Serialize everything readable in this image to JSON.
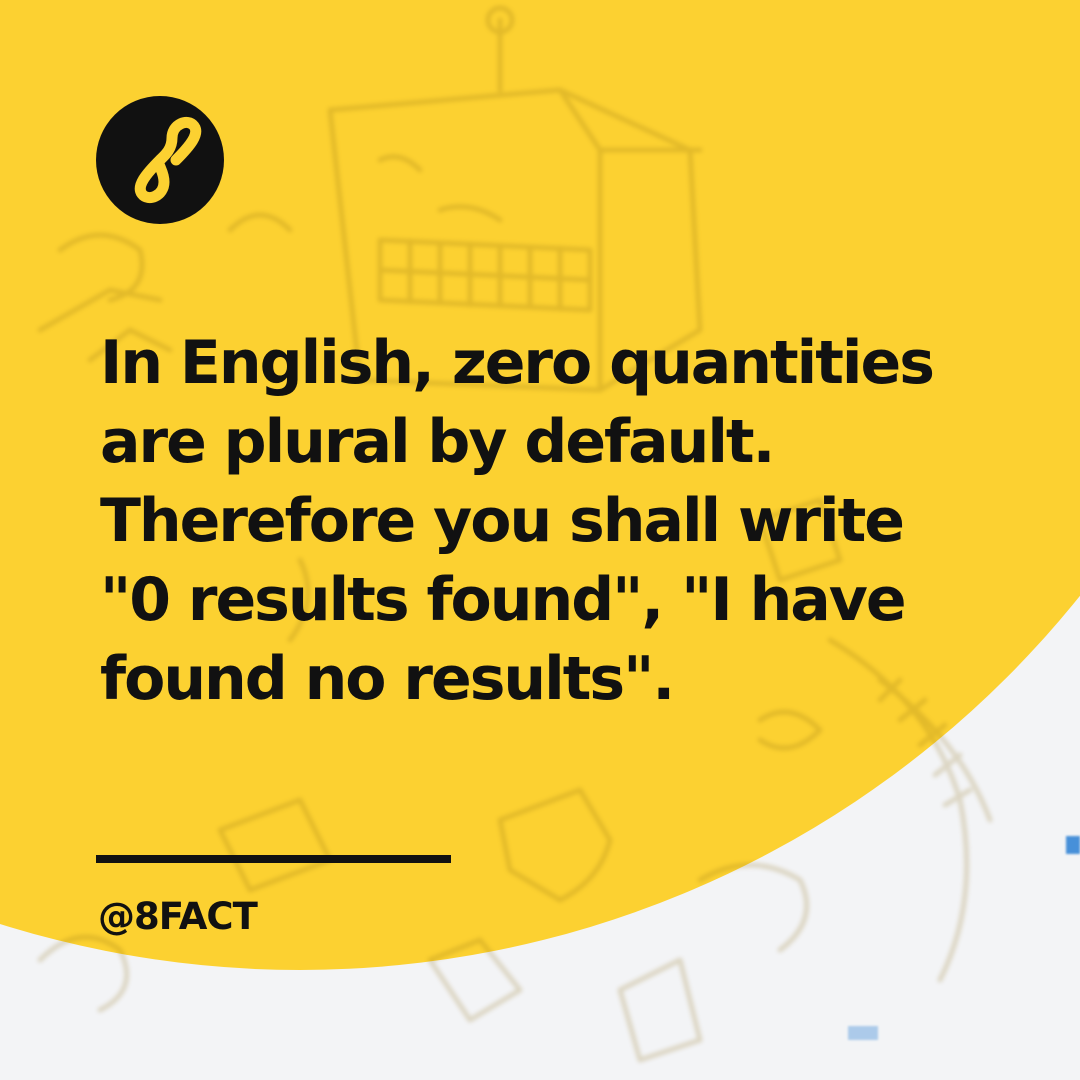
{
  "post": {
    "logo_icon": "figure-eight-icon",
    "fact_lines": [
      "In English, zero quantities",
      "are plural by default.",
      "Therefore you shall write",
      "\"0 results found\", \"I have",
      "found no results\"."
    ],
    "handle": "@8FACT"
  },
  "colors": {
    "background": "#fcd131",
    "text": "#111111",
    "corner": "#f3f4f6"
  }
}
